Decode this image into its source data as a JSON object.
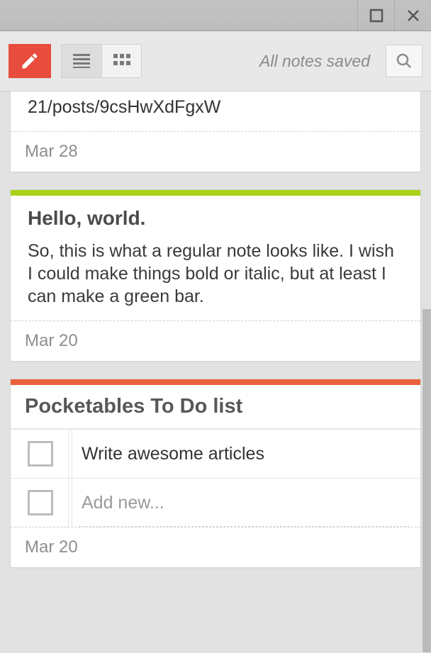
{
  "toolbar": {
    "saved_status": "All notes saved"
  },
  "notes": {
    "partial": {
      "body_fragment": "21/posts/9csHwXdFgxW",
      "date": "Mar 28"
    },
    "hello": {
      "title": "Hello, world.",
      "body": "So, this is what a regular note looks like. I wish I could make things bold or italic, but at least I can make a green bar.",
      "date": "Mar 20"
    },
    "todo": {
      "title": "Pocketables To Do list",
      "items": [
        {
          "text": "Write awesome articles",
          "done": false
        }
      ],
      "add_placeholder": "Add new...",
      "date": "Mar 20"
    }
  },
  "colors": {
    "compose": "#e74c3c",
    "green_bar": "#aad21a",
    "orange_bar": "#e9603c"
  }
}
